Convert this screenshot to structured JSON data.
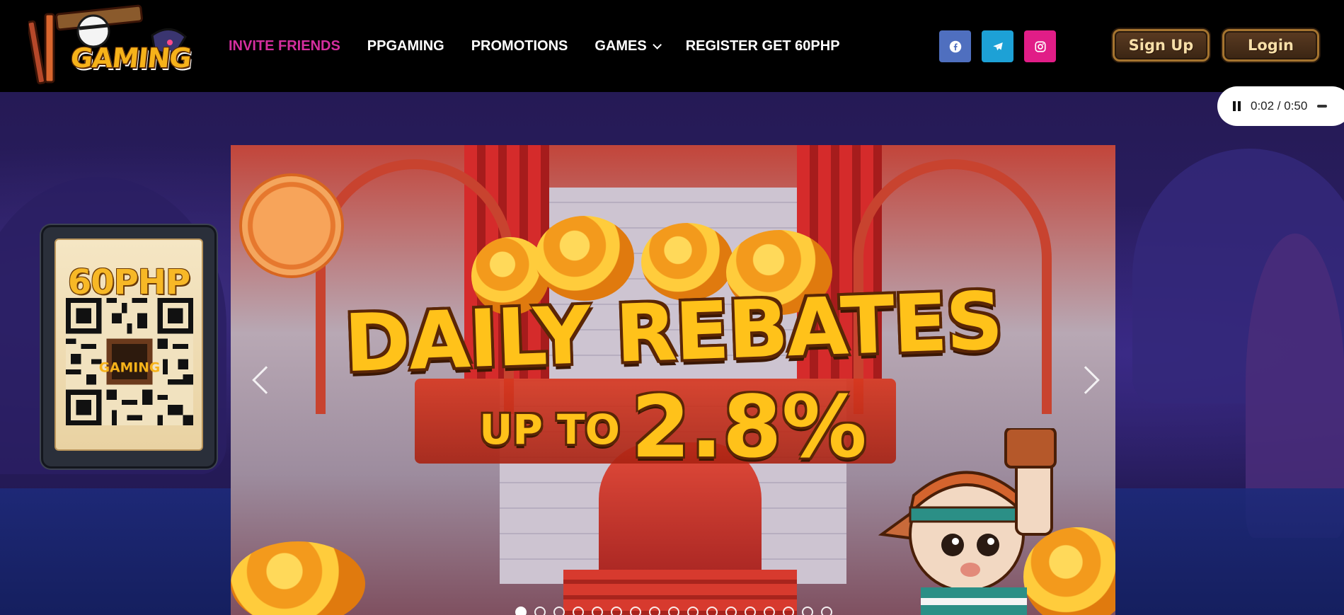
{
  "brand": {
    "logo_text": "GAMING",
    "logo_icon": "pirate-mascot-icon"
  },
  "nav": {
    "items": [
      {
        "label": "INVITE FRIENDS",
        "active": true
      },
      {
        "label": "PPGAMING",
        "active": false
      },
      {
        "label": "PROMOTIONS",
        "active": false
      },
      {
        "label": "GAMES",
        "active": false,
        "has_dropdown": true
      },
      {
        "label": "REGISTER GET 60PHP",
        "active": false
      }
    ],
    "active_color": "#d42e9e"
  },
  "social": [
    {
      "icon": "facebook-icon",
      "color": "#4f6fbf"
    },
    {
      "icon": "telegram-icon",
      "color": "#1da1d6"
    },
    {
      "icon": "instagram-icon",
      "color": "#e11d87"
    }
  ],
  "auth": {
    "signup_label": "Sign Up",
    "login_label": "Login"
  },
  "audio": {
    "time": "0:02 / 0:50",
    "state": "playing"
  },
  "promo_card": {
    "amount": "60PHP",
    "qr_logo_text": "GAMING"
  },
  "banner": {
    "headline": "DAILY REBATES",
    "upto": "UP TO",
    "percent": "2.8%",
    "slide_count": 17,
    "active_slide": 0
  }
}
